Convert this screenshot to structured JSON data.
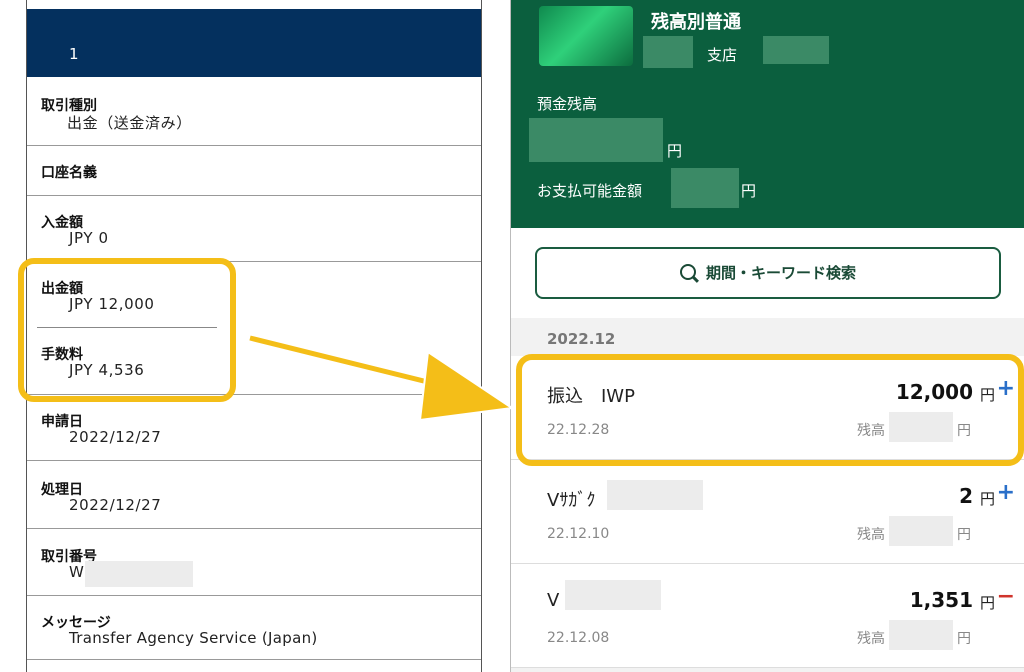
{
  "left": {
    "header_number": "1",
    "rows": [
      {
        "label": "取引種別",
        "value": "出金（送金済み）"
      },
      {
        "label": "口座名義",
        "value": ""
      },
      {
        "label": "入金額",
        "value": "JPY 0"
      },
      {
        "label": "出金額",
        "value": "JPY 12,000"
      },
      {
        "label": "手数料",
        "value": "JPY 4,536"
      },
      {
        "label": "申請日",
        "value": "2022/12/27"
      },
      {
        "label": "処理日",
        "value": "2022/12/27"
      },
      {
        "label": "取引番号",
        "value": "W"
      },
      {
        "label": "メッセージ",
        "value": "Transfer Agency Service (Japan)"
      }
    ]
  },
  "right": {
    "account_type": "残高別普通",
    "branch_suffix": "支店",
    "deposit_balance_label": "預金残高",
    "yen": "円",
    "available_label": "お支払可能金額",
    "search_label": "期間・キーワード検索",
    "month": "2022.12",
    "balance_label": "残高",
    "transactions": [
      {
        "name": "振込　IWP",
        "date": "22.12.28",
        "amount": "12,000",
        "unit": "円",
        "sign": "+",
        "sign_color": "#2a6fc9"
      },
      {
        "name": "Vｻｶﾞｸ",
        "date": "22.12.10",
        "amount": "2",
        "unit": "円",
        "sign": "+",
        "sign_color": "#2a6fc9"
      },
      {
        "name": "V",
        "date": "22.12.08",
        "amount": "1,351",
        "unit": "円",
        "sign": "−",
        "sign_color": "#d0342c"
      }
    ]
  },
  "colors": {
    "left_header": "#04305e",
    "right_header": "#0b5f3e",
    "highlight": "#f4be18"
  }
}
